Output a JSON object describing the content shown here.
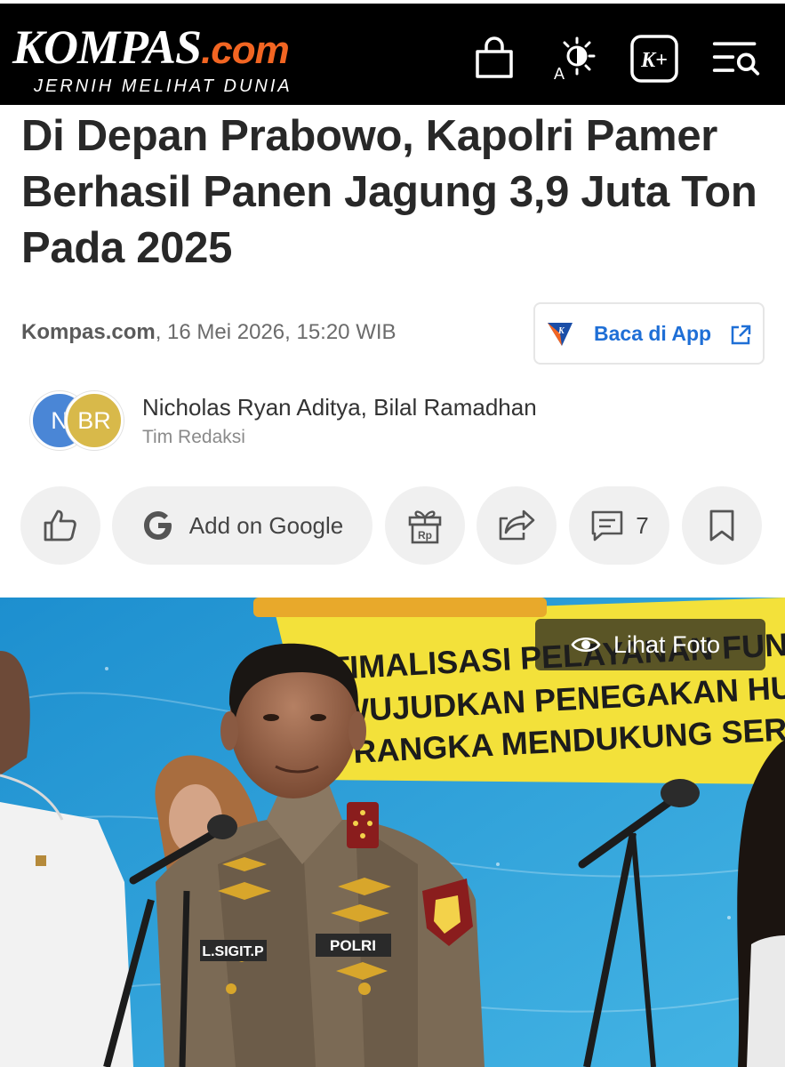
{
  "header": {
    "logo_main": "KOMPAS",
    "logo_suffix": ".com",
    "tagline": "JERNIH MELIHAT DUNIA",
    "icons": [
      "shopping-bag-icon",
      "font-contrast-icon",
      "kompas-plus-icon",
      "menu-search-icon"
    ],
    "kplus_label": "K+",
    "contrast_label": "A"
  },
  "article": {
    "title": "Di Depan Prabowo, Kapolri Pamer Berhasil Panen Jagung 3,9 Juta Ton Pada 2025",
    "source": "Kompas.com",
    "datetime": ", 16 Mei 2026, 15:20 WIB",
    "app_button_label": "Baca di App",
    "authors": "Nicholas Ryan Aditya,  Bilal Ramadhan",
    "team": "Tim Redaksi",
    "avatar_1": "N",
    "avatar_2": "BR"
  },
  "actions": {
    "google_label": "Add on Google",
    "gift_label": "Rp",
    "comment_count": "7"
  },
  "photo": {
    "view_label": "Lihat Foto",
    "banner_lines": [
      "TIMALISASI PELAYANAN FUNGS",
      "WUJUDKAN PENEGAKAN HUKU",
      "RANGKA MENDUKUNG SERT"
    ],
    "name_tag": "L.SIGIT.P",
    "polri_tag": "POLRI"
  },
  "colors": {
    "header_bg": "#000000",
    "brand_orange": "#f26522",
    "link_blue": "#1f6fd6",
    "button_bg": "#f0f0f0",
    "banner_yellow": "#f3e13a",
    "photo_blue": "#2fa3d8"
  }
}
